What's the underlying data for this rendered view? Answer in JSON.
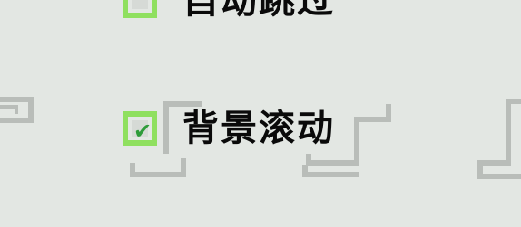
{
  "colors": {
    "background": "#e3e7e3",
    "checkbox_border": "#8fe05f",
    "checkmark": "#2e9c3a",
    "frame": "#b9bdb9"
  },
  "options": [
    {
      "label": "自动跳过",
      "checked": false,
      "icon": "checkbox-empty-icon"
    },
    {
      "label": "背景滚动",
      "checked": true,
      "icon": "checkmark-icon"
    }
  ]
}
